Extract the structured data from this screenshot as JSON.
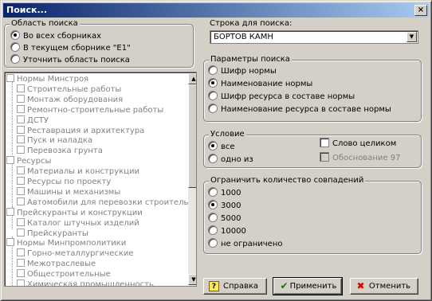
{
  "window": {
    "title": "Поиск..."
  },
  "icons": {
    "close": "×",
    "ok": "✔",
    "cancel": "✖",
    "help": "?"
  },
  "search_area": {
    "title": "Область поиска",
    "options": [
      "Во всех сборниках",
      "В текущем сборнике \"Е1\"",
      "Уточнить область поиска"
    ],
    "selected": 0
  },
  "tree": {
    "items": [
      {
        "label": "Нормы Минстроя",
        "level": 0
      },
      {
        "label": "Строительные работы",
        "level": 1
      },
      {
        "label": "Монтаж оборудования",
        "level": 1
      },
      {
        "label": "Ремонтно-строительные работы",
        "level": 1
      },
      {
        "label": "ДСТУ",
        "level": 1
      },
      {
        "label": "Реставрация и архитектура",
        "level": 1
      },
      {
        "label": "Пуск и наладка",
        "level": 1
      },
      {
        "label": "Перевозка грунта",
        "level": 1
      },
      {
        "label": "Ресурсы",
        "level": 0
      },
      {
        "label": "Материалы и конструкции",
        "level": 1
      },
      {
        "label": "Ресурсы по проекту",
        "level": 1
      },
      {
        "label": "Машины и механизмы",
        "level": 1
      },
      {
        "label": "Автомобили для перевозки строительных грузов",
        "level": 1
      },
      {
        "label": "Прейскуранты и конструкции",
        "level": 0
      },
      {
        "label": "Каталог штучных изделий",
        "level": 1
      },
      {
        "label": "Прейскуранты",
        "level": 1
      },
      {
        "label": "Нормы Минпромполитики",
        "level": 0
      },
      {
        "label": "Горно-металлургические",
        "level": 1
      },
      {
        "label": "Межотраслевые",
        "level": 1
      },
      {
        "label": "Общестроительные",
        "level": 1
      },
      {
        "label": "Химическая промышленность",
        "level": 1
      }
    ]
  },
  "search_string": {
    "label": "Строка для поиска:",
    "value": "БОРТОВ КАМН"
  },
  "search_params": {
    "title": "Параметры поиска",
    "options": [
      "Шифр нормы",
      "Наименование нормы",
      "Шифр ресурса  в составе нормы",
      "Наименование ресурса  в составе нормы"
    ],
    "selected": 1
  },
  "condition": {
    "title": "Условие",
    "options": [
      "все",
      "одно из"
    ],
    "selected": 0,
    "whole_word": "Слово целиком",
    "justification": "Обоснование 97"
  },
  "limit": {
    "title": "Ограничить количество совпадений",
    "options": [
      "1000",
      "3000",
      "5000",
      "10000",
      "не ограничено"
    ],
    "selected": 1
  },
  "buttons": {
    "help": "Справка",
    "apply": "Применить",
    "cancel": "Отменить"
  }
}
